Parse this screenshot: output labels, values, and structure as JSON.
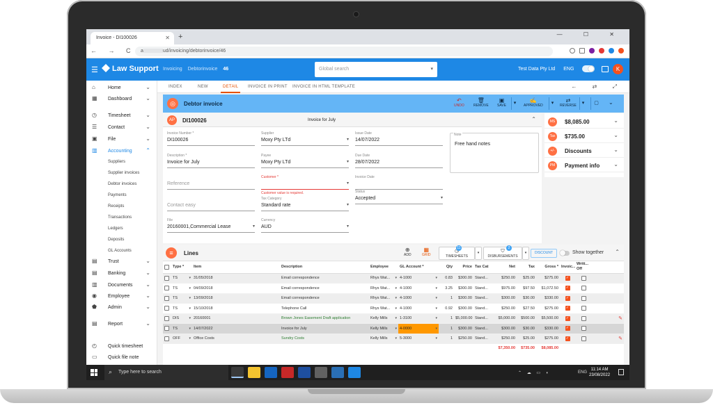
{
  "browser": {
    "tab_title": "Invoice - DI100026",
    "new_tab": "+",
    "url_host": "a",
    "url_path": "ud/invoicing/debtorinvoice/46",
    "nav": "← → C ⌂",
    "win_controls": "— ☐ ✕"
  },
  "header": {
    "app_name": "Law Support",
    "crumb1": "Invoicing",
    "crumb2": "Debtorinvoice",
    "crumb3": "46",
    "search_placeholder": "Global search",
    "company": "Test Data Pty Ltd",
    "lang": "ENG",
    "avatar": "K",
    "accent": "#1e88e5"
  },
  "sidebar": {
    "items": [
      {
        "label": "Home",
        "icon": "home-icon",
        "glyph": "⌂",
        "chevron": "⌄"
      },
      {
        "label": "Dashboard",
        "icon": "dashboard-icon",
        "glyph": "▦",
        "chevron": "⌄"
      },
      {
        "label": "Timesheet",
        "icon": "clock-icon",
        "glyph": "◷",
        "chevron": "⌄"
      },
      {
        "label": "Contact",
        "icon": "contact-icon",
        "glyph": "☰",
        "chevron": "⌄"
      },
      {
        "label": "File",
        "icon": "briefcase-icon",
        "glyph": "▣",
        "chevron": "⌄"
      },
      {
        "label": "Accounting",
        "icon": "bank-icon",
        "glyph": "▥",
        "chevron": "⌃"
      },
      {
        "label": "Trust",
        "icon": "trust-icon",
        "glyph": "▤",
        "chevron": "⌄"
      },
      {
        "label": "Banking",
        "icon": "banking-icon",
        "glyph": "▤",
        "chevron": "⌄"
      },
      {
        "label": "Documents",
        "icon": "documents-icon",
        "glyph": "▥",
        "chevron": "⌄"
      },
      {
        "label": "Employee",
        "icon": "employee-icon",
        "glyph": "◉",
        "chevron": "⌄"
      },
      {
        "label": "Admin",
        "icon": "admin-icon",
        "glyph": "⬟",
        "chevron": "⌄"
      },
      {
        "label": "Report",
        "icon": "report-icon",
        "glyph": "▤",
        "chevron": "⌄"
      },
      {
        "label": "Quick timesheet",
        "icon": "timer-icon",
        "glyph": "◴",
        "chevron": ""
      },
      {
        "label": "Quick file note",
        "icon": "note-icon",
        "glyph": "▭",
        "chevron": ""
      }
    ],
    "sub_items": [
      "Suppliers",
      "Supplier invoices",
      "Debtor invoices",
      "Payments",
      "Receipts",
      "Transactions",
      "Ledgers",
      "Deposits",
      "GL Accounts"
    ]
  },
  "subtabs": [
    "INDEX",
    "NEW",
    "DETAIL",
    "INVOICE IN PRINT",
    "INVOICE IN HTML TEMPLATE"
  ],
  "subtab_icons": "← ⇄ ⤢",
  "toolbar": {
    "title": "Debtor invoice",
    "undo": "UNDO",
    "remove": "REMOVE",
    "save": "SAVE",
    "approved": "APPROVED",
    "reverse": "REVERSE",
    "chevron": "▾",
    "comment": "▢",
    "collapse": "⌄"
  },
  "invoice": {
    "avatar": "AP",
    "number": "DI100026",
    "header_desc": "Invoice for July",
    "collapse": "⌃",
    "fields": {
      "invoice_number": {
        "label": "Invoice Number *",
        "value": "DI100026"
      },
      "supplier": {
        "label": "Supplier",
        "value": "Moxy Pty LTd"
      },
      "issue_date": {
        "label": "Issue Date",
        "value": "14/07/2022"
      },
      "description": {
        "label": "Description *",
        "value": "Invoice for July"
      },
      "payee": {
        "label": "Payee",
        "value": "Moxy Pty LTd"
      },
      "due_date": {
        "label": "Due Date",
        "value": "28/07/2022"
      },
      "reference": {
        "placeholder": "Reference"
      },
      "customer": {
        "label": "Customer *",
        "error": "Customer value is required."
      },
      "invoice_date": {
        "label": "Invoice Date"
      },
      "contact": {
        "placeholder": "Contact easy"
      },
      "tax_category": {
        "label": "Tax Category",
        "value": "Standard rate"
      },
      "status": {
        "label": "Status",
        "value": "Accepted"
      },
      "file": {
        "label": "File",
        "value": "20160001,Commercial Lease"
      },
      "currency": {
        "label": "Currency",
        "value": "AUD"
      },
      "note": {
        "label": "Note",
        "value": "Free hand notes"
      }
    }
  },
  "summary": [
    {
      "badge": "MS",
      "text": "$8,085.00"
    },
    {
      "badge": "Tax",
      "text": "$735.00"
    },
    {
      "badge": "+/-",
      "text": "Discounts"
    },
    {
      "badge": "PM",
      "text": "Payment info"
    }
  ],
  "lines": {
    "title": "Lines",
    "add": "ADD",
    "grid": "GRID",
    "timesheets": "TIMESHEETS",
    "timesheets_count": "11",
    "disbursements": "DISBURSEMENTS",
    "disbursements_count": "2",
    "discount": "DISCOUNT",
    "show_together": "Show together",
    "columns": [
      "Type *",
      "Item",
      "Description",
      "Employee",
      "GL Account *",
      "Qty",
      "Price",
      "Tax Cat",
      "Net",
      "Tax",
      "Gross *",
      "Invoic...",
      "Writt... Off"
    ],
    "rows": [
      {
        "type": "TS",
        "item": "31/05/2018",
        "desc": "Email correspondence",
        "emp": "Rhys Wat...",
        "gl": "4-1000",
        "qty": "0.83",
        "price": "$300.00",
        "tax_cat": "Stand...",
        "net": "$250.00",
        "tax": "$25.00",
        "gross": "$275.00",
        "inv": true,
        "wo": false
      },
      {
        "type": "TS",
        "item": "04/09/2018",
        "desc": "Email correspondence",
        "emp": "Rhys Wat...",
        "gl": "4-1000",
        "qty": "3.25",
        "price": "$300.00",
        "tax_cat": "Stand...",
        "net": "$975.00",
        "tax": "$97.50",
        "gross": "$1,072.50",
        "inv": true,
        "wo": false
      },
      {
        "type": "TS",
        "item": "13/09/2018",
        "desc": "Email correspondence",
        "emp": "Rhys Wat...",
        "gl": "4-1000",
        "qty": "1",
        "price": "$300.00",
        "tax_cat": "Stand...",
        "net": "$300.00",
        "tax": "$30.00",
        "gross": "$330.00",
        "inv": true,
        "wo": false
      },
      {
        "type": "TS",
        "item": "15/10/2018",
        "desc": "Telephone Call",
        "emp": "Rhys Wat...",
        "gl": "4-1000",
        "qty": "0.92",
        "price": "$300.00",
        "tax_cat": "Stand...",
        "net": "$250.00",
        "tax": "$27.50",
        "gross": "$275.00",
        "inv": true,
        "wo": false
      },
      {
        "type": "DIS",
        "item": "20160001",
        "desc": "Brown Jones Easement Draft application",
        "emp": "Kelly Mills",
        "gl": "1-3100",
        "qty": "1",
        "price": "$5,000.00",
        "tax_cat": "Stand...",
        "net": "$5,000.00",
        "tax": "$500.00",
        "gross": "$5,500.00",
        "inv": true,
        "wo": false
      },
      {
        "type": "TS",
        "item": "14/07/2022",
        "desc": "Invoice for July",
        "emp": "Kelly Mills",
        "gl": "4-0000",
        "qty": "1",
        "price": "$300.00",
        "tax_cat": "Stand...",
        "net": "$300.00",
        "tax": "$30.00",
        "gross": "$330.00",
        "inv": true,
        "wo": false
      },
      {
        "type": "OFF",
        "item": "Office Costs",
        "desc": "Sundry Costs",
        "emp": "Kelly Mills",
        "gl": "5-3000",
        "qty": "1",
        "price": "$250.00",
        "tax_cat": "Stand...",
        "net": "$250.00",
        "tax": "$25.00",
        "gross": "$275.00",
        "inv": true,
        "wo": false
      }
    ],
    "totals": {
      "net": "$7,350.00",
      "tax": "$735.00",
      "gross": "$8,085.00"
    }
  },
  "taskbar": {
    "search": "Type here to search",
    "time": "11:14 AM",
    "date": "23/08/2022",
    "lang": "ENG",
    "tray": "⌃ ☁ ▭ ◖"
  }
}
